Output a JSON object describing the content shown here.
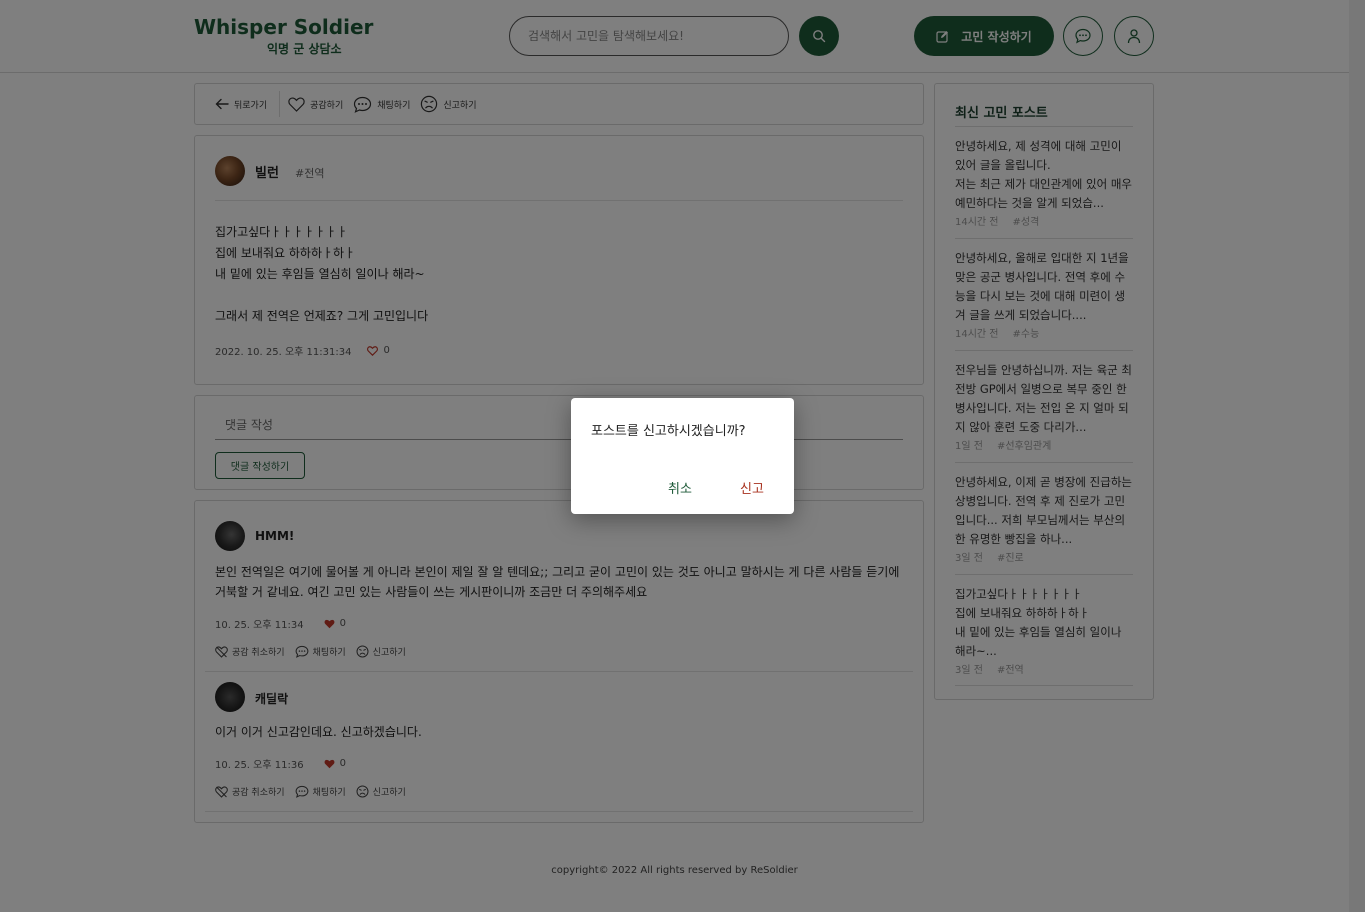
{
  "header": {
    "logo_title": "Whisper Soldier",
    "logo_sub": "익명 군 상담소",
    "search_placeholder": "검색해서 고민을 탐색해보세요!",
    "write_label": "고민 작성하기",
    "brand_color": "#1e5a38"
  },
  "toolbar": {
    "back": "뒤로가기",
    "like": "공감하기",
    "chat": "채팅하기",
    "report": "신고하기"
  },
  "post": {
    "author": "빌런",
    "tag": "#전역",
    "body": "집가고싶다ㅏㅏㅏㅏㅏㅏㅏ\n집에 보내줘요 하하하ㅏ하ㅏ\n내 밑에 있는 후임들 열심히 일이나 해라~\n\n그래서 제 전역은 언제죠? 그게 고민입니다",
    "date": "2022. 10. 25. 오후 11:31:34",
    "likes": "0"
  },
  "comment_write": {
    "placeholder": "댓글 작성",
    "button": "댓글 작성하기"
  },
  "comments": [
    {
      "author": "HMM!",
      "body": "본인 전역일은 여기에 물어볼 게 아니라 본인이 제일 잘 알 텐데요;; 그리고 굳이 고민이 있는 것도 아니고 말하시는 게 다른 사람들 듣기에 거북할 거 같네요. 여긴 고민 있는 사람들이 쓰는 게시판이니까 조금만 더 주의해주세요",
      "date": "10. 25. 오후 11:34",
      "likes": "0",
      "unlike": "공감 취소하기",
      "chat": "채팅하기",
      "report": "신고하기"
    },
    {
      "author": "캐딜락",
      "body": "이거 이거 신고감인데요. 신고하겠습니다.",
      "date": "10. 25. 오후 11:36",
      "likes": "0",
      "unlike": "공감 취소하기",
      "chat": "채팅하기",
      "report": "신고하기"
    }
  ],
  "sidebar": {
    "title": "최신 고민 포스트",
    "items": [
      {
        "text": "안녕하세요, 제 성격에 대해 고민이 있어 글을 올립니다.\n저는 최근 제가 대인관계에 있어 매우 예민하다는 것을 알게 되었습...",
        "time": "14시간 전",
        "tag": "#성격"
      },
      {
        "text": "안녕하세요, 올해로 입대한 지 1년을 맞은 공군 병사입니다. 전역 후에 수능을 다시 보는 것에 대해 미련이 생겨 글을 쓰게 되었습니다....",
        "time": "14시간 전",
        "tag": "#수능"
      },
      {
        "text": "전우님들 안녕하십니까. 저는 육군 최전방 GP에서 일병으로 복무 중인 한 병사입니다. 저는 전입 온 지 얼마 되지 않아 훈련 도중 다리가...",
        "time": "1일 전",
        "tag": "#선후임관계"
      },
      {
        "text": "안녕하세요, 이제 곧 병장에 진급하는 상병입니다. 전역 후 제 진로가 고민입니다... 저희 부모님께서는 부산의 한 유명한 빵집을 하나...",
        "time": "3일 전",
        "tag": "#진로"
      },
      {
        "text": "집가고싶다ㅏㅏㅏㅏㅏㅏㅏ\n집에 보내줘요 하하하ㅏ하ㅏ\n내 밑에 있는 후임들 열심히 일이나 해라~...",
        "time": "3일 전",
        "tag": "#전역"
      }
    ]
  },
  "footer": {
    "text": "copyright© 2022 All rights reserved by ReSoldier"
  },
  "dialog": {
    "message": "포스트를 신고하시겠습니까?",
    "cancel": "취소",
    "confirm": "신고",
    "cancel_color": "#1e5a38",
    "confirm_color": "#a8321f"
  }
}
